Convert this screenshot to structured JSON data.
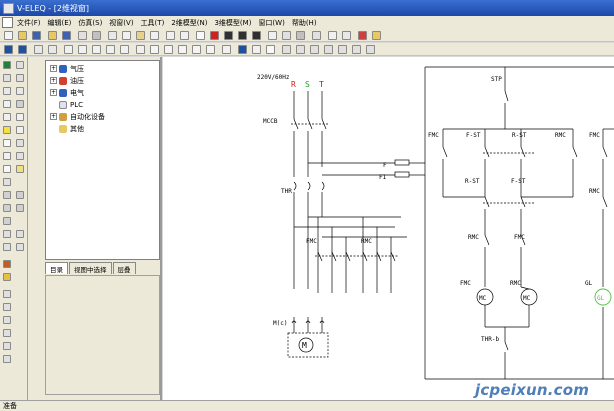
{
  "window": {
    "title": "V-ELEQ - [2维视窗]"
  },
  "menu": [
    "文件(F)",
    "编辑(E)",
    "仿真(S)",
    "视窗(V)",
    "工具(T)",
    "2维模型(N)",
    "3维模型(M)",
    "窗口(W)",
    "帮助(H)"
  ],
  "library": {
    "tree": [
      {
        "label": "气压",
        "expand": "+"
      },
      {
        "label": "油压",
        "expand": "+"
      },
      {
        "label": "电气",
        "expand": "+"
      },
      {
        "label": "PLC",
        "expand": ""
      },
      {
        "label": "自动化设备",
        "expand": "+"
      },
      {
        "label": "其他",
        "expand": ""
      }
    ],
    "tabs": [
      "目录",
      "视图中选择",
      "层叠"
    ]
  },
  "schematic": {
    "supply": "220V/60Hz",
    "phase_r": "R",
    "phase_s": "S",
    "phase_t": "T",
    "mccb": "MCCB",
    "thr": "THR",
    "fmc1": "FMC",
    "rmc1": "RMC",
    "m_label": "M(c)",
    "motor": "M",
    "f_label": "F",
    "f1_label": "F1",
    "stp": "STP",
    "fmc_top_left": "FMC",
    "f_st_top": "F-ST",
    "r_st_top": "R-ST",
    "rmc_top": "RMC",
    "fmc_far_right": "FMC",
    "r_st_mid": "R-ST",
    "f_st_mid": "F-ST",
    "rmc_far_right": "RMC",
    "rmc_mid": "RMC",
    "fmc_mid": "FMC",
    "coil_fmc_label": "FMC",
    "coil_rmc_label": "RMC",
    "coil_mc1": "MC",
    "coil_mc2": "MC",
    "gl_label": "GL",
    "gl_coil": "GL",
    "thr_b": "THR-b"
  },
  "watermark": "jcpeixun.com",
  "status": "准备",
  "colors": {
    "phase_r": "#d02020",
    "phase_s": "#20a020",
    "phase_t": "#2040d0",
    "gl": "#50c040"
  }
}
